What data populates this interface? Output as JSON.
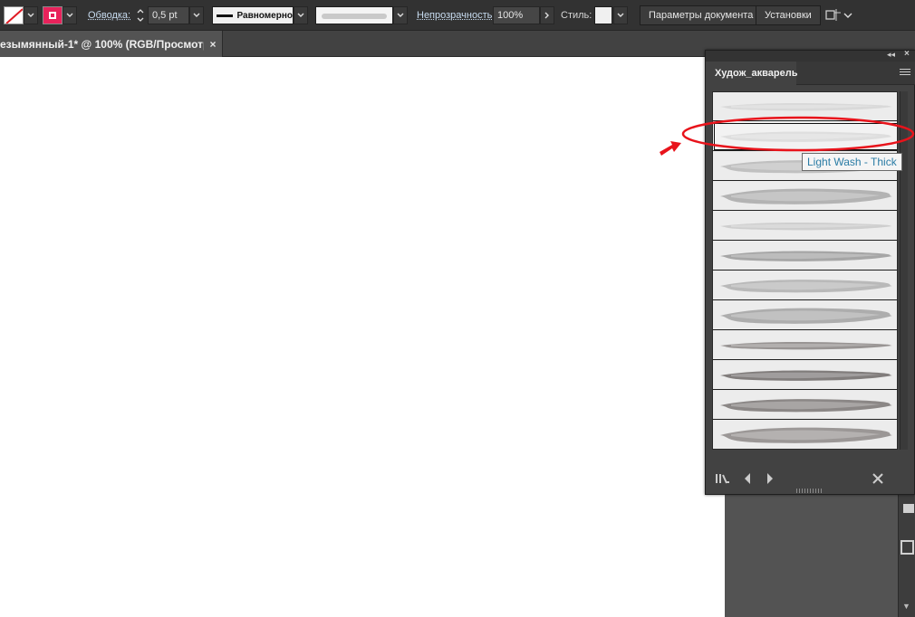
{
  "control_bar": {
    "stroke_label": "Обводка:",
    "stroke_weight": "0,5 pt",
    "profile_label": "Равномерно",
    "opacity_label": "Непрозрачность:",
    "opacity_value": "100%",
    "style_label": "Стиль:",
    "doc_setup_button": "Параметры документа",
    "preferences_button": "Установки"
  },
  "document_tab": {
    "title": "езымянный-1* @ 100% (RGB/Просмотр)",
    "close_glyph": "×"
  },
  "panel": {
    "tab_label": "Худож_акварель",
    "tooltip": "Light Wash - Thick",
    "brushes": [
      {
        "name": "brush-1"
      },
      {
        "name": "Light Wash - Thick",
        "selected": true
      },
      {
        "name": "brush-3"
      },
      {
        "name": "brush-4"
      },
      {
        "name": "brush-5"
      },
      {
        "name": "brush-6"
      },
      {
        "name": "brush-7"
      },
      {
        "name": "brush-8"
      },
      {
        "name": "brush-9"
      },
      {
        "name": "brush-10"
      },
      {
        "name": "brush-11"
      },
      {
        "name": "brush-12"
      }
    ],
    "footer_icons": [
      "brush-libraries-icon",
      "previous-arrow-icon",
      "next-arrow-icon",
      "remove-brush-icon"
    ]
  },
  "colors": {
    "accent_stroke": "#e8225b",
    "annotation_red": "#e8131b",
    "tooltip_text": "#2a7ca5"
  }
}
